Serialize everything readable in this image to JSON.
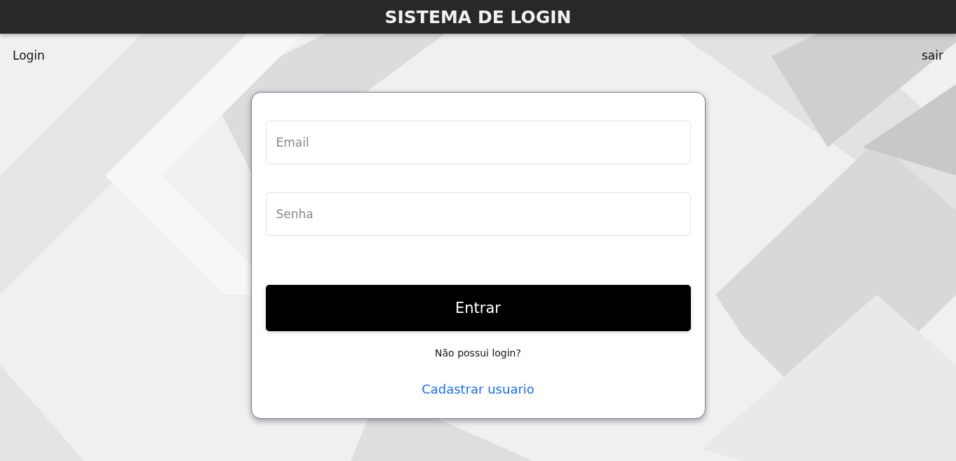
{
  "header": {
    "title": "SISTEMA DE LOGIN"
  },
  "nav": {
    "left_link": "Login",
    "right_link": "sair"
  },
  "login_form": {
    "fields": [
      {
        "placeholder": "Email"
      },
      {
        "placeholder": "Senha"
      }
    ],
    "submit_button": "Entrar",
    "prompt": "Não possui login?",
    "register_link": "Cadastrar usuario"
  }
}
